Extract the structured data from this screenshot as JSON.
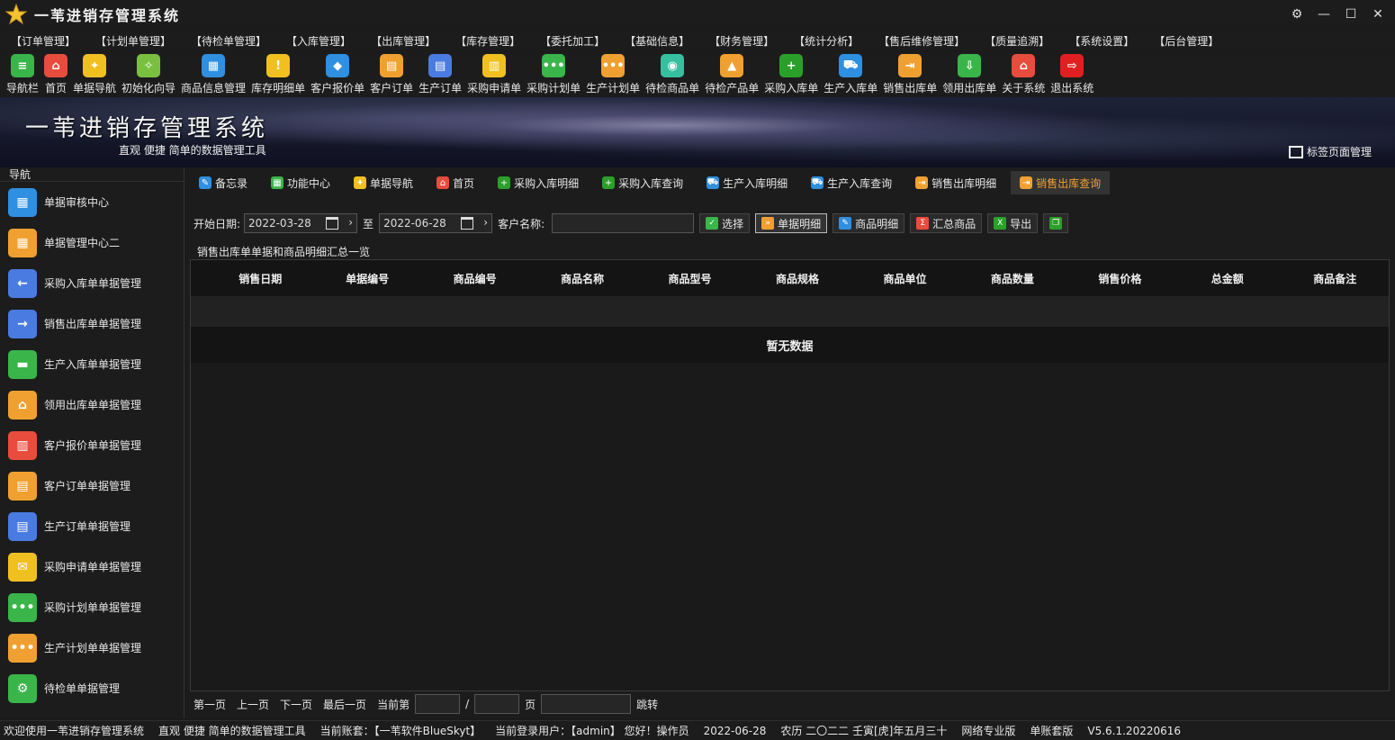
{
  "window": {
    "title": "一苇进销存管理系统",
    "controls": [
      "gear-icon",
      "minimize-icon",
      "maximize-icon",
      "close-icon"
    ]
  },
  "menu": [
    "【订单管理】",
    "【计划单管理】",
    "【待检单管理】",
    "【入库管理】",
    "【出库管理】",
    "【库存管理】",
    "【委托加工】",
    "【基础信息】",
    "【财务管理】",
    "【统计分析】",
    "【售后维修管理】",
    "【质量追溯】",
    "【系统设置】",
    "【后台管理】"
  ],
  "toolbar": [
    {
      "label": "导航栏",
      "icon": "menu-icon",
      "color": "#3ab54a"
    },
    {
      "label": "首页",
      "icon": "home-icon",
      "color": "#e84c3d"
    },
    {
      "label": "单据导航",
      "icon": "compass-icon",
      "color": "#f0c020"
    },
    {
      "label": "初始化向导",
      "icon": "wand-icon",
      "color": "#7ac040"
    },
    {
      "label": "商品信息管理",
      "icon": "cubes-icon",
      "color": "#2f8fe0"
    },
    {
      "label": "库存明细单",
      "icon": "warning-icon",
      "color": "#f0c020"
    },
    {
      "label": "客户报价单",
      "icon": "tag-icon",
      "color": "#2f8fe0"
    },
    {
      "label": "客户订单",
      "icon": "doc-icon",
      "color": "#f0a030"
    },
    {
      "label": "生产订单",
      "icon": "doc-icon",
      "color": "#4a7be0"
    },
    {
      "label": "采购申请单",
      "icon": "clipboard-icon",
      "color": "#f0c020"
    },
    {
      "label": "采购计划单",
      "icon": "chat-icon",
      "color": "#3ab54a"
    },
    {
      "label": "生产计划单",
      "icon": "chat-icon",
      "color": "#f0a030"
    },
    {
      "label": "待检商品单",
      "icon": "flask-icon",
      "color": "#36c0a0"
    },
    {
      "label": "待检产品单",
      "icon": "beaker-icon",
      "color": "#f0a030"
    },
    {
      "label": "采购入库单",
      "icon": "plus-icon",
      "color": "#2aa02a"
    },
    {
      "label": "生产入库单",
      "icon": "cart-icon",
      "color": "#2f8fe0"
    },
    {
      "label": "销售出库单",
      "icon": "export-icon",
      "color": "#f0a030"
    },
    {
      "label": "领用出库单",
      "icon": "download-icon",
      "color": "#3ab54a"
    },
    {
      "label": "关于系统",
      "icon": "house-icon",
      "color": "#e84c3d"
    },
    {
      "label": "退出系统",
      "icon": "exit-icon",
      "color": "#e02020"
    }
  ],
  "banner": {
    "title": "一苇进销存管理系统",
    "subtitle": "直观 便捷 简单的数据管理工具",
    "tab_manager": "标签页面管理"
  },
  "nav": {
    "header": "导航",
    "items": [
      {
        "label": "单据审核中心",
        "icon": "grid-icon",
        "color": "#2f8fe0"
      },
      {
        "label": "单据管理中心二",
        "icon": "grid-icon",
        "color": "#f0a030"
      },
      {
        "label": "采购入库单单据管理",
        "icon": "arrow-left-icon",
        "color": "#4a7be0"
      },
      {
        "label": "销售出库单单据管理",
        "icon": "arrow-right-icon",
        "color": "#4a7be0"
      },
      {
        "label": "生产入库单单据管理",
        "icon": "folder-icon",
        "color": "#3ab54a"
      },
      {
        "label": "领用出库单单据管理",
        "icon": "house-icon",
        "color": "#f0a030"
      },
      {
        "label": "客户报价单单据管理",
        "icon": "books-icon",
        "color": "#e84c3d"
      },
      {
        "label": "客户订单单据管理",
        "icon": "doc-icon",
        "color": "#f0a030"
      },
      {
        "label": "生产订单单据管理",
        "icon": "doc-icon",
        "color": "#4a7be0"
      },
      {
        "label": "采购申请单单据管理",
        "icon": "envelope-icon",
        "color": "#f0c020"
      },
      {
        "label": "采购计划单单据管理",
        "icon": "chat-icon",
        "color": "#3ab54a"
      },
      {
        "label": "生产计划单单据管理",
        "icon": "chat-icon",
        "color": "#f0a030"
      },
      {
        "label": "待检单单据管理",
        "icon": "doc-gear-icon",
        "color": "#3ab54a"
      }
    ]
  },
  "tabs": [
    {
      "label": "备忘录",
      "icon": "memo-icon",
      "color": "#2f8fe0",
      "active": false
    },
    {
      "label": "功能中心",
      "icon": "grid-icon",
      "color": "#3ab54a",
      "active": false
    },
    {
      "label": "单据导航",
      "icon": "compass-icon",
      "color": "#f0c020",
      "active": false
    },
    {
      "label": "首页",
      "icon": "home-icon",
      "color": "#e84c3d",
      "active": false
    },
    {
      "label": "采购入库明细",
      "icon": "plus-icon",
      "color": "#2aa02a",
      "active": false
    },
    {
      "label": "采购入库查询",
      "icon": "plus-icon",
      "color": "#2aa02a",
      "active": false
    },
    {
      "label": "生产入库明细",
      "icon": "cart-icon",
      "color": "#2f8fe0",
      "active": false
    },
    {
      "label": "生产入库查询",
      "icon": "cart-icon",
      "color": "#2f8fe0",
      "active": false
    },
    {
      "label": "销售出库明细",
      "icon": "export-icon",
      "color": "#f0a030",
      "active": false
    },
    {
      "label": "销售出库查询",
      "icon": "export-icon",
      "color": "#f0a030",
      "active": true
    }
  ],
  "filters": {
    "start_label": "开始日期:",
    "start_date": "2022-03-28",
    "to_label": "至",
    "end_date": "2022-06-28",
    "customer_label": "客户名称:",
    "customer_value": "",
    "buttons": [
      {
        "label": "选择",
        "icon": "select-icon",
        "color": "#3ab54a"
      },
      {
        "label": "单据明细",
        "icon": "detail-icon",
        "color": "#f0a030"
      },
      {
        "label": "商品明细",
        "icon": "edit-icon",
        "color": "#2f8fe0"
      },
      {
        "label": "汇总商品",
        "icon": "summary-icon",
        "color": "#e84c3d"
      },
      {
        "label": "导出",
        "icon": "excel-icon",
        "color": "#2aa02a"
      },
      {
        "label": "",
        "icon": "copy-icon",
        "color": "#2aa02a"
      }
    ]
  },
  "grid": {
    "title": "销售出库单单据和商品明细汇总一览",
    "columns": [
      "销售日期",
      "单据编号",
      "商品编号",
      "商品名称",
      "商品型号",
      "商品规格",
      "商品单位",
      "商品数量",
      "销售价格",
      "总金额",
      "商品备注"
    ],
    "empty_text": "暂无数据"
  },
  "pager": {
    "first": "第一页",
    "prev": "上一页",
    "next": "下一页",
    "last": "最后一页",
    "current_label": "当前第",
    "slash": "/",
    "page_unit": "页",
    "jump": "跳转"
  },
  "status": [
    "欢迎使用一苇进销存管理系统",
    "直观 便捷 简单的数据管理工具",
    "当前账套：【一苇软件BlueSkyt】",
    "当前登录用户：【admin】 您好！操作员",
    "2022-06-28",
    "农历 二〇二二 壬寅[虎]年五月三十",
    "网络专业版",
    "单账套版",
    "V5.6.1.20220616"
  ]
}
